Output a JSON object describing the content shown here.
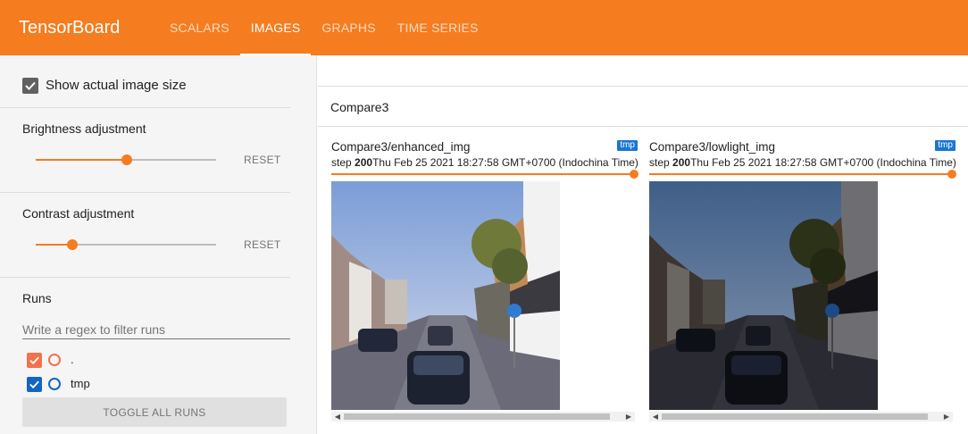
{
  "app": {
    "title": "TensorBoard"
  },
  "tabs": [
    {
      "label": "SCALARS",
      "active": false
    },
    {
      "label": "IMAGES",
      "active": true
    },
    {
      "label": "GRAPHS",
      "active": false
    },
    {
      "label": "TIME SERIES",
      "active": false
    }
  ],
  "sidebar": {
    "show_actual_size": {
      "label": "Show actual image size",
      "checked": true
    },
    "brightness": {
      "label": "Brightness adjustment",
      "value": 0.5,
      "reset_label": "RESET"
    },
    "contrast": {
      "label": "Contrast adjustment",
      "value": 0.2,
      "reset_label": "RESET"
    },
    "runs": {
      "title": "Runs",
      "filter_placeholder": "Write a regex to filter runs",
      "items": [
        {
          "name": ".",
          "checked": true,
          "color": "#f4714b"
        },
        {
          "name": "tmp",
          "checked": true,
          "color": "#1565c0"
        }
      ],
      "toggle_all_label": "TOGGLE ALL RUNS"
    }
  },
  "main": {
    "group_title": "Compare3",
    "cards": [
      {
        "title": "Compare3/enhanced_img",
        "run_badge": "tmp",
        "step_label": "step",
        "step": "200",
        "timestamp": "Thu Feb 25 2021 18:27:58 GMT+0700 (Indochina Time)"
      },
      {
        "title": "Compare3/lowlight_img",
        "run_badge": "tmp",
        "step_label": "step",
        "step": "200",
        "timestamp": "Thu Feb 25 2021 18:27:58 GMT+0700 (Indochina Time)"
      }
    ]
  },
  "colors": {
    "accent": "#f57c1f",
    "badge": "#1976d2"
  }
}
